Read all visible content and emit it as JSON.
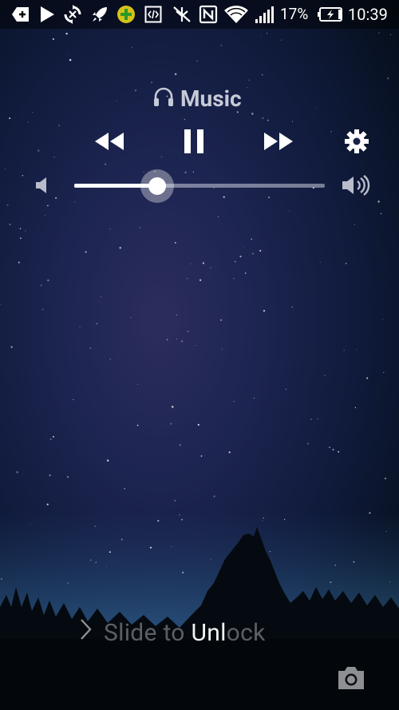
{
  "status_bar": {
    "icons": [
      "add-box-icon",
      "play-store-icon",
      "sync-icon",
      "rocket-icon",
      "green-plus-icon",
      "code-icon",
      "signal-off-icon",
      "nfc-icon",
      "wifi-icon",
      "cell-signal-icon",
      "battery-charging-icon"
    ],
    "battery_percent": "17%",
    "time": "10:39"
  },
  "music": {
    "header_icon": "headphones-icon",
    "title": "Music",
    "controls": [
      "rewind-icon",
      "pause-icon",
      "fast-forward-icon",
      "settings-icon"
    ],
    "volume_level": 0.33,
    "volume_low_icon": "volume-low-icon",
    "volume_high_icon": "volume-high-icon"
  },
  "unlock": {
    "prefix": "Slide to ",
    "highlight": "Unl",
    "suffix": "ock",
    "arrow_icon": "chevron-right-icon"
  },
  "camera": {
    "icon": "camera-icon"
  },
  "colors": {
    "sky_top": "#0f1a3a",
    "sky_glow": "#2c2d5c",
    "trees": "#050a10"
  }
}
